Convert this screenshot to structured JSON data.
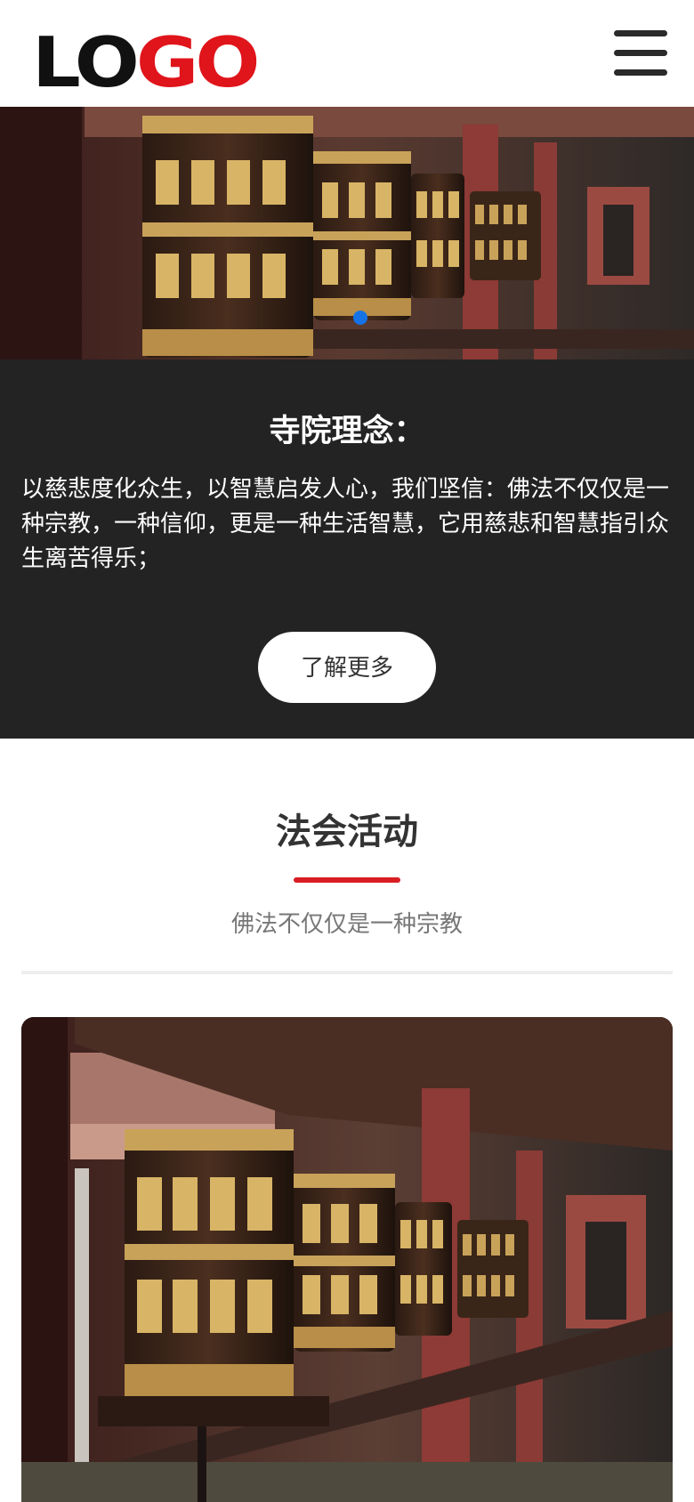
{
  "header": {
    "logo_left": "LO",
    "logo_right": "GO",
    "menu_icon": "hamburger-menu-icon"
  },
  "banner": {
    "image": "prayer-wheels-photo",
    "slides_total": 1,
    "active_slide": 1,
    "indicator_color": "#1673e6"
  },
  "concept": {
    "title": "寺院理念：",
    "text": "以慈悲度化众生，以智慧启发人心，我们坚信：佛法不仅仅是一种宗教，一种信仰，更是一种生活智慧，它用慈悲和智慧指引众生离苦得乐；",
    "button_label": "了解更多",
    "background": "#232323"
  },
  "activities": {
    "title": "法会活动",
    "subtitle": "佛法不仅仅是一种宗教",
    "accent_color": "#d81e23",
    "card_image": "prayer-wheels-photo"
  }
}
